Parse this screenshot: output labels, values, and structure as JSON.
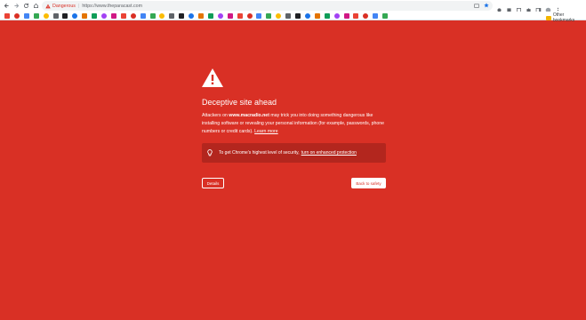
{
  "browser": {
    "security_label": "Dangerous",
    "url": "https://www.theparacast.com",
    "other_bookmarks_label": "Other bookmarks"
  },
  "bookmarks": {
    "icons": [
      "gmail-icon",
      "youtube-icon",
      "google-icon",
      "mail-icon",
      "folder-icon",
      "maps-icon",
      "drive-icon",
      "calendar-icon",
      "news-icon",
      "photos-icon",
      "docs-icon",
      "sheets-icon",
      "slides-icon",
      "translate-icon",
      "play-icon",
      "twitter-icon",
      "facebook-icon",
      "reddit-icon",
      "amazon-icon",
      "netflix-icon",
      "spotify-icon",
      "github-icon",
      "wikipedia-icon",
      "linkedin-icon",
      "pinterest-icon",
      "instagram-icon",
      "tiktok-icon",
      "discord-icon",
      "slack-icon",
      "dropbox-icon",
      "twitch-icon",
      "medium-icon",
      "stackoverflow-icon",
      "imdb-icon",
      "ebay-icon",
      "paypal-icon",
      "weather-icon",
      "music-icon",
      "shop-icon",
      "star-icon"
    ]
  },
  "interstitial": {
    "title": "Deceptive site ahead",
    "body_prefix": "Attackers on ",
    "site": "www.macradio.net",
    "body_suffix": " may trick you into doing something dangerous like installing software or revealing your personal information (for example, passwords, phone numbers or credit cards).",
    "learn_more": "Learn more",
    "promo_text": "To get Chrome's highest level of security,",
    "promo_link": "turn on enhanced protection",
    "details_button": "Details",
    "back_button": "Back to safety"
  },
  "colors": {
    "background": "#d93025",
    "promo_background": "#b3261e"
  }
}
